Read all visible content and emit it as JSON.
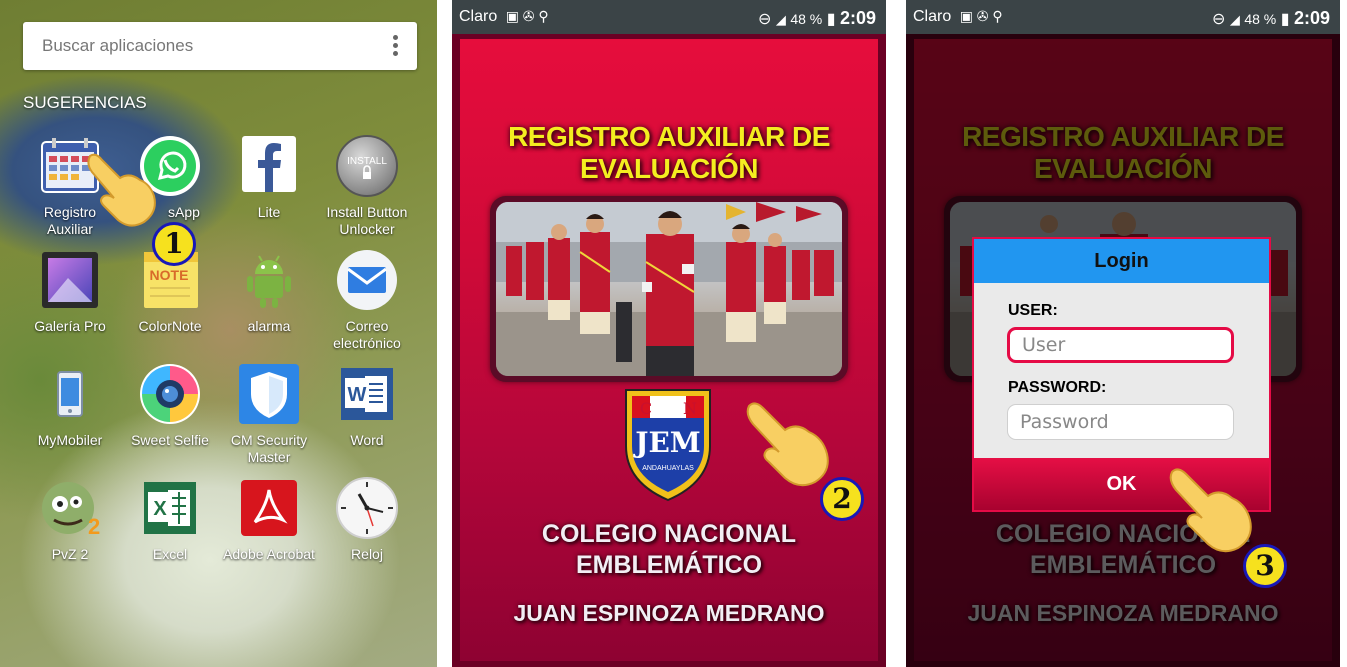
{
  "launcher": {
    "search_placeholder": "Buscar aplicaciones",
    "section_title": "SUGERENCIAS",
    "apps": [
      {
        "label": "Registro\nAuxiliar",
        "icon": "calendar-icon"
      },
      {
        "label": "WhatsApp",
        "visible_label": "sApp",
        "icon": "whatsapp-icon"
      },
      {
        "label": "Lite",
        "icon": "facebook-icon"
      },
      {
        "label": "Install Button\nUnlocker",
        "icon": "install-icon",
        "icon_text": "INSTALL"
      },
      {
        "label": "Galería Pro",
        "icon": "gallery-icon"
      },
      {
        "label": "ColorNote",
        "icon": "note-icon",
        "icon_text": "NOTE"
      },
      {
        "label": "alarma",
        "icon": "android-icon"
      },
      {
        "label": "Correo\nelectrónico",
        "icon": "mail-icon"
      },
      {
        "label": "MyMobiler",
        "icon": "phone-icon"
      },
      {
        "label": "Sweet Selfie",
        "icon": "camera-icon"
      },
      {
        "label": "CM Security\nMaster",
        "icon": "shield-icon"
      },
      {
        "label": "Word",
        "icon": "word-icon",
        "icon_text": "W"
      },
      {
        "label": "PvZ 2",
        "icon": "zombie-icon"
      },
      {
        "label": "Excel",
        "icon": "excel-icon",
        "icon_text": "X"
      },
      {
        "label": "Adobe Acrobat",
        "icon": "acrobat-icon"
      },
      {
        "label": "Reloj",
        "icon": "clock-icon"
      }
    ],
    "step_number": "1"
  },
  "status_bar": {
    "carrier": "Claro",
    "battery": "48 %",
    "time": "2:09"
  },
  "app_screen": {
    "title_line1": "REGISTRO AUXILIAR DE",
    "title_line2": "EVALUACIÓN",
    "logo_letters": [
      "C",
      "N"
    ],
    "logo_main": "JEM",
    "logo_sub": "ANDAHUAYLAS",
    "school_line1": "COLEGIO NACIONAL",
    "school_line2": "EMBLEMÁTICO",
    "school_name": "JUAN ESPINOZA MEDRANO",
    "step_number": "2"
  },
  "login": {
    "title": "Login",
    "user_label": "USER:",
    "user_placeholder": "User",
    "password_label": "PASSWORD:",
    "password_placeholder": "Password",
    "ok_label": "OK",
    "step_number": "3"
  },
  "colors": {
    "accent_red": "#e50b46",
    "title_yellow": "#f4ee20",
    "dialog_header_blue": "#2196f0",
    "step_badge_yellow": "#f6e11e",
    "step_badge_border": "#1818b8"
  }
}
